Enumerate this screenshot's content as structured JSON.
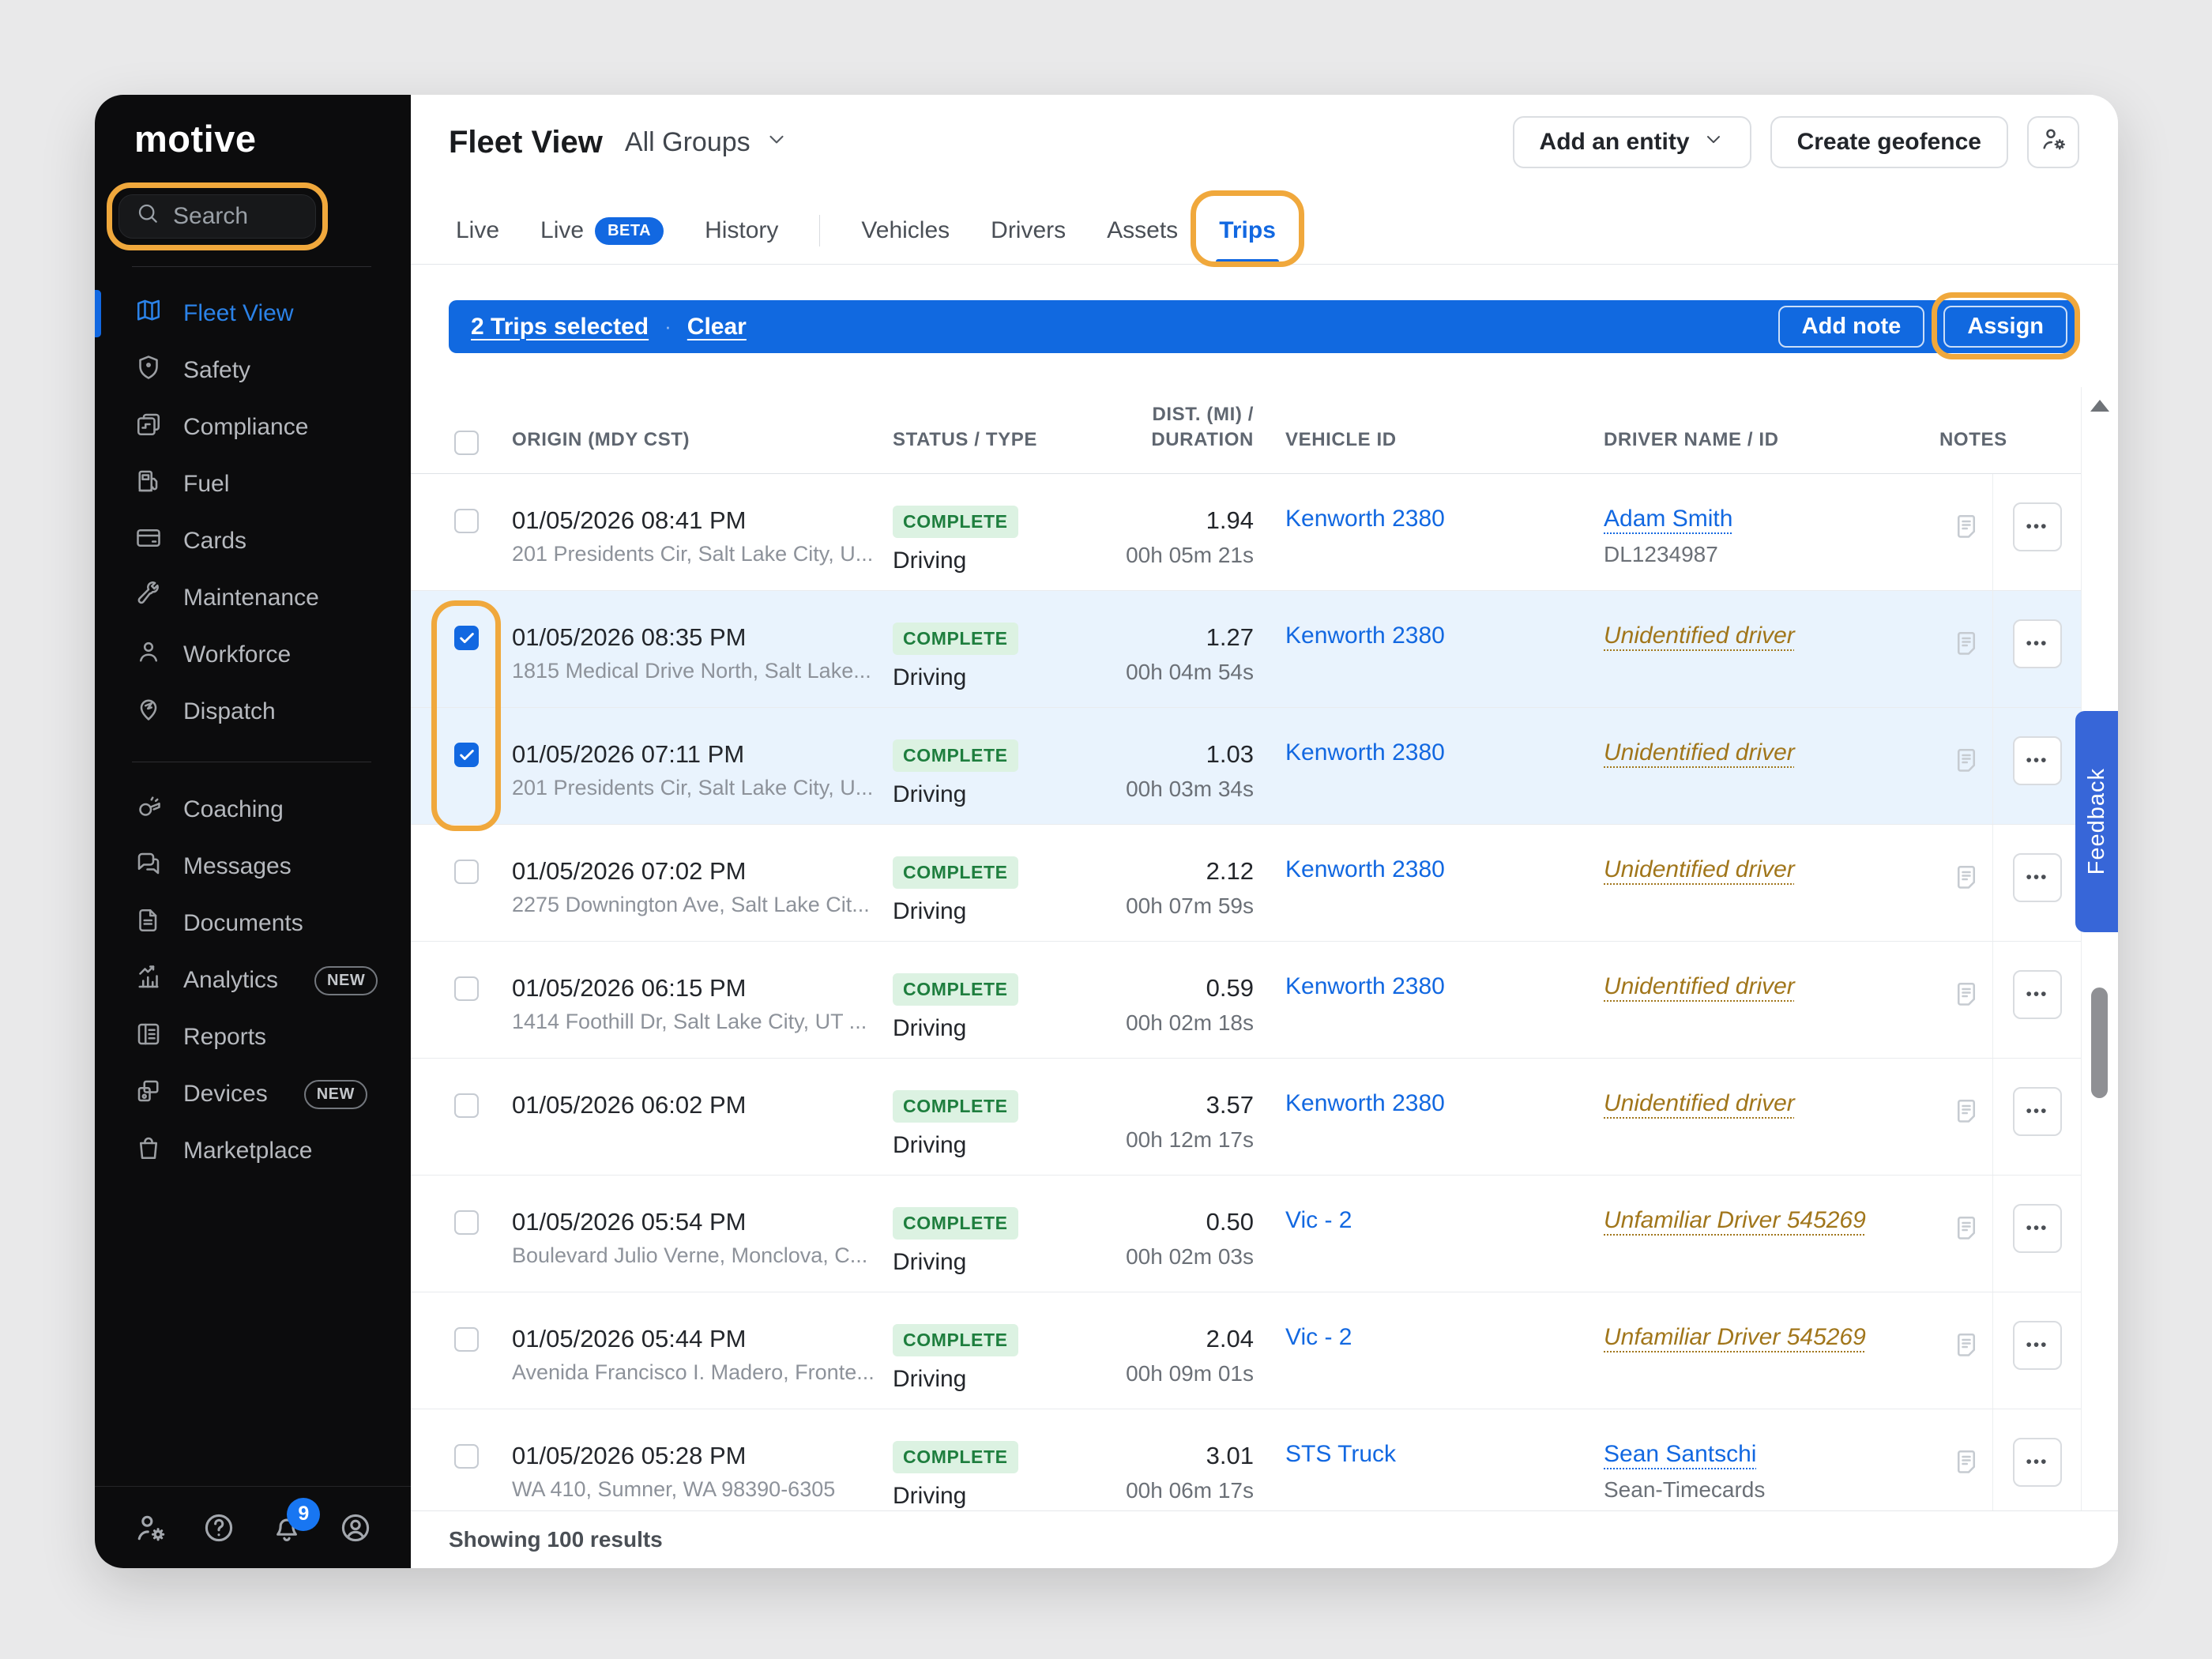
{
  "colors": {
    "brand_blue": "#1268E1",
    "highlight_orange": "#F0A83C",
    "status_green_bg": "#DCF2E2",
    "status_green_text": "#1E7E3E",
    "unidentified_amber": "#A1761B",
    "selected_row_bg": "#E9F3FD",
    "sidebar_bg": "#0C0C0D",
    "feedback_blue": "#3766D8"
  },
  "sidebar": {
    "logo": "motive",
    "search_placeholder": "Search",
    "items_primary": [
      {
        "label": "Fleet View",
        "icon": "map-icon",
        "active": true
      },
      {
        "label": "Safety",
        "icon": "shield-icon"
      },
      {
        "label": "Compliance",
        "icon": "compliance-icon"
      },
      {
        "label": "Fuel",
        "icon": "fuel-icon"
      },
      {
        "label": "Cards",
        "icon": "card-icon"
      },
      {
        "label": "Maintenance",
        "icon": "wrench-icon"
      },
      {
        "label": "Workforce",
        "icon": "person-icon"
      },
      {
        "label": "Dispatch",
        "icon": "dispatch-pin-icon"
      }
    ],
    "items_secondary": [
      {
        "label": "Coaching",
        "icon": "whistle-icon"
      },
      {
        "label": "Messages",
        "icon": "chat-icon"
      },
      {
        "label": "Documents",
        "icon": "document-icon"
      },
      {
        "label": "Analytics",
        "icon": "analytics-icon",
        "badge": "NEW"
      },
      {
        "label": "Reports",
        "icon": "report-icon"
      },
      {
        "label": "Devices",
        "icon": "devices-icon",
        "badge": "NEW"
      },
      {
        "label": "Marketplace",
        "icon": "bag-icon"
      }
    ],
    "footer_icons": [
      {
        "name": "admin",
        "icon": "user-gear-icon"
      },
      {
        "name": "help",
        "icon": "help-icon"
      },
      {
        "name": "notifications",
        "icon": "bell-icon",
        "badge": "9"
      },
      {
        "name": "account",
        "icon": "avatar-icon"
      }
    ]
  },
  "header": {
    "title": "Fleet View",
    "group_selector": "All Groups",
    "add_entity_label": "Add an entity",
    "create_geofence_label": "Create geofence"
  },
  "tabs": [
    {
      "label": "Live"
    },
    {
      "label": "Live",
      "badge": "BETA"
    },
    {
      "label": "History",
      "sep_after": true
    },
    {
      "label": "Vehicles"
    },
    {
      "label": "Drivers"
    },
    {
      "label": "Assets"
    },
    {
      "label": "Trips",
      "active": true,
      "highlighted": true
    }
  ],
  "selection_bar": {
    "selected_text": "2 Trips selected",
    "clear_label": "Clear",
    "add_note_label": "Add note",
    "assign_label": "Assign"
  },
  "table": {
    "columns": {
      "origin": "ORIGIN (MDY CST)",
      "status": "STATUS / TYPE",
      "dist_line1": "DIST. (MI) /",
      "dist_line2": "DURATION",
      "vehicle": "VEHICLE ID",
      "driver": "DRIVER NAME / ID",
      "notes": "NOTES"
    },
    "rows": [
      {
        "datetime": "01/05/2026 08:41 PM",
        "address": "201 Presidents Cir, Salt Lake City, U...",
        "status": "COMPLETE",
        "type": "Driving",
        "distance": "1.94",
        "duration": "00h 05m 21s",
        "vehicle": "Kenworth 2380",
        "driver": "Adam Smith",
        "driver_style": "named",
        "driver_sub": "DL1234987",
        "selected": false
      },
      {
        "datetime": "01/05/2026 08:35 PM",
        "address": "1815 Medical Drive North, Salt Lake...",
        "status": "COMPLETE",
        "type": "Driving",
        "distance": "1.27",
        "duration": "00h 04m 54s",
        "vehicle": "Kenworth 2380",
        "driver": "Unidentified driver",
        "driver_style": "unidentified",
        "driver_sub": "",
        "selected": true
      },
      {
        "datetime": "01/05/2026 07:11 PM",
        "address": "201 Presidents Cir, Salt Lake City, U...",
        "status": "COMPLETE",
        "type": "Driving",
        "distance": "1.03",
        "duration": "00h 03m 34s",
        "vehicle": "Kenworth 2380",
        "driver": "Unidentified driver",
        "driver_style": "unidentified",
        "driver_sub": "",
        "selected": true
      },
      {
        "datetime": "01/05/2026 07:02 PM",
        "address": "2275 Downington Ave, Salt Lake Cit...",
        "status": "COMPLETE",
        "type": "Driving",
        "distance": "2.12",
        "duration": "00h 07m 59s",
        "vehicle": "Kenworth 2380",
        "driver": "Unidentified driver",
        "driver_style": "unidentified",
        "driver_sub": "",
        "selected": false
      },
      {
        "datetime": "01/05/2026 06:15 PM",
        "address": "1414 Foothill Dr, Salt Lake City, UT ...",
        "status": "COMPLETE",
        "type": "Driving",
        "distance": "0.59",
        "duration": "00h 02m 18s",
        "vehicle": "Kenworth 2380",
        "driver": "Unidentified driver",
        "driver_style": "unidentified",
        "driver_sub": "",
        "selected": false
      },
      {
        "datetime": "01/05/2026 06:02 PM",
        "address": "",
        "status": "COMPLETE",
        "type": "Driving",
        "distance": "3.57",
        "duration": "00h 12m 17s",
        "vehicle": "Kenworth 2380",
        "driver": "Unidentified driver",
        "driver_style": "unidentified",
        "driver_sub": "",
        "selected": false
      },
      {
        "datetime": "01/05/2026 05:54 PM",
        "address": "Boulevard Julio Verne, Monclova, C...",
        "status": "COMPLETE",
        "type": "Driving",
        "distance": "0.50",
        "duration": "00h 02m 03s",
        "vehicle": "Vic - 2",
        "driver": "Unfamiliar Driver 545269",
        "driver_style": "unfamiliar",
        "driver_sub": "",
        "selected": false
      },
      {
        "datetime": "01/05/2026 05:44 PM",
        "address": "Avenida Francisco I. Madero, Fronte...",
        "status": "COMPLETE",
        "type": "Driving",
        "distance": "2.04",
        "duration": "00h 09m 01s",
        "vehicle": "Vic - 2",
        "driver": "Unfamiliar Driver 545269",
        "driver_style": "unfamiliar",
        "driver_sub": "",
        "selected": false
      },
      {
        "datetime": "01/05/2026 05:28 PM",
        "address": "WA 410, Sumner, WA 98390-6305",
        "status": "COMPLETE",
        "type": "Driving",
        "distance": "3.01",
        "duration": "00h 06m 17s",
        "vehicle": "STS Truck",
        "driver": "Sean Santschi",
        "driver_style": "named",
        "driver_sub": "Sean-Timecards",
        "selected": false
      }
    ]
  },
  "footer": {
    "results_text": "Showing 100 results"
  },
  "feedback_label": "Feedback"
}
